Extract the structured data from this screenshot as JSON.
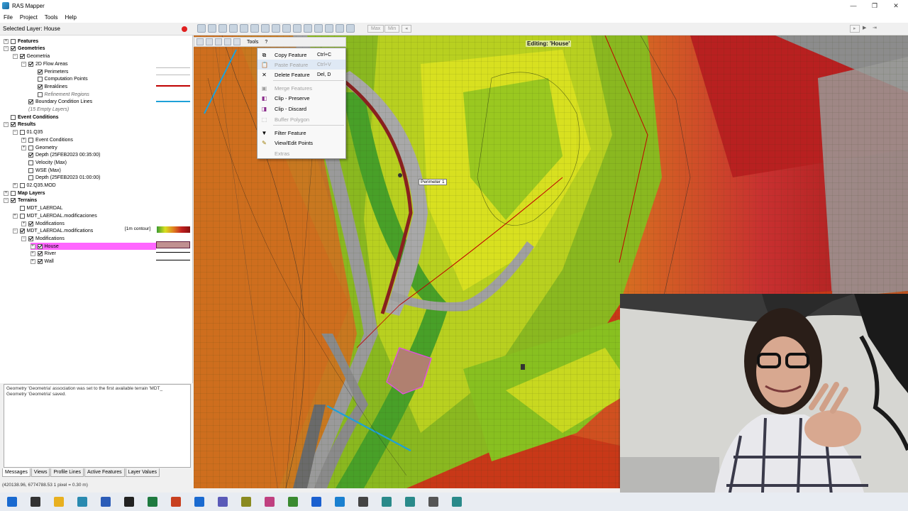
{
  "window": {
    "title": "RAS Mapper",
    "min_icon": "minimize-icon",
    "max_icon": "maximize-icon",
    "close_icon": "close-icon"
  },
  "menu": [
    "File",
    "Project",
    "Tools",
    "Help"
  ],
  "toolbar": {
    "selected_layer": "Selected Layer: House",
    "max_label": "Max",
    "min_label": "Min"
  },
  "tree": [
    {
      "label": "Features",
      "indent": 0,
      "exp": "+",
      "checked": false,
      "style": "bold"
    },
    {
      "label": "Geometries",
      "indent": 0,
      "exp": "−",
      "checked": true,
      "style": "bold"
    },
    {
      "label": "Geometria",
      "indent": 1,
      "exp": "−",
      "checked": true,
      "style": ""
    },
    {
      "label": "2D Flow Areas",
      "indent": 2,
      "exp": "−",
      "checked": true,
      "style": ""
    },
    {
      "label": "Perimeters",
      "indent": 3,
      "exp": "",
      "checked": true,
      "style": ""
    },
    {
      "label": "Computation Points",
      "indent": 3,
      "exp": "",
      "checked": false,
      "style": ""
    },
    {
      "label": "Breaklines",
      "indent": 3,
      "exp": "",
      "checked": true,
      "style": ""
    },
    {
      "label": "Refinement Regions",
      "indent": 3,
      "exp": "",
      "checked": false,
      "style": "italic"
    },
    {
      "label": "Boundary Condition Lines",
      "indent": 2,
      "exp": "",
      "checked": true,
      "style": ""
    },
    {
      "label": "(15 Empty Layers)",
      "indent": 2,
      "exp": "",
      "checked": null,
      "style": "italic"
    },
    {
      "label": "Event Conditions",
      "indent": 0,
      "exp": "",
      "checked": false,
      "style": "bold"
    },
    {
      "label": "Results",
      "indent": 0,
      "exp": "−",
      "checked": true,
      "style": "bold"
    },
    {
      "label": "01.Q35",
      "indent": 1,
      "exp": "−",
      "checked": false,
      "style": ""
    },
    {
      "label": "Event Conditions",
      "indent": 2,
      "exp": "+",
      "checked": false,
      "style": ""
    },
    {
      "label": "Geometry",
      "indent": 2,
      "exp": "+",
      "checked": false,
      "style": ""
    },
    {
      "label": "Depth (25FEB2023 00:35:00)",
      "indent": 2,
      "exp": "",
      "checked": true,
      "style": ""
    },
    {
      "label": "Velocity (Max)",
      "indent": 2,
      "exp": "",
      "checked": false,
      "style": ""
    },
    {
      "label": "WSE (Max)",
      "indent": 2,
      "exp": "",
      "checked": false,
      "style": ""
    },
    {
      "label": "Depth (25FEB2023 01:00:00)",
      "indent": 2,
      "exp": "",
      "checked": false,
      "style": ""
    },
    {
      "label": "02.Q35.MOD",
      "indent": 1,
      "exp": "+",
      "checked": false,
      "style": ""
    },
    {
      "label": "Map Layers",
      "indent": 0,
      "exp": "+",
      "checked": false,
      "style": "bold"
    },
    {
      "label": "Terrains",
      "indent": 0,
      "exp": "−",
      "checked": true,
      "style": "bold"
    },
    {
      "label": "MDT_LAERDAL",
      "indent": 1,
      "exp": "",
      "checked": false,
      "style": ""
    },
    {
      "label": "MDT_LAERDAL.modificaciones",
      "indent": 1,
      "exp": "+",
      "checked": false,
      "style": ""
    },
    {
      "label": "Modifications",
      "indent": 2,
      "exp": "+",
      "checked": true,
      "style": ""
    },
    {
      "label": "MDT_LAERDAL.modifications",
      "indent": 1,
      "exp": "−",
      "checked": true,
      "style": ""
    },
    {
      "label": "Modifications",
      "indent": 2,
      "exp": "−",
      "checked": true,
      "style": ""
    },
    {
      "label": "House",
      "indent": 3,
      "exp": "+",
      "checked": true,
      "style": "selected"
    },
    {
      "label": "River",
      "indent": 3,
      "exp": "+",
      "checked": true,
      "style": ""
    },
    {
      "label": "Wall",
      "indent": 3,
      "exp": "+",
      "checked": true,
      "style": ""
    }
  ],
  "contour_label": "[1m contour]",
  "log": {
    "line1": "Geometry 'Geometria' association was set to the first available terrain 'MDT_",
    "line2": "Geometry 'Geometria' saved."
  },
  "bottom_tabs": [
    "Messages",
    "Views",
    "Profile Lines",
    "Active Features",
    "Layer Values"
  ],
  "status": "(420138.96, 6774788.53  1 pixel = 0.30 m)",
  "map": {
    "editing": "Editing: 'House'",
    "tools_label": "Tools",
    "help_label": "?",
    "perimeter_label": "Perimeter 1"
  },
  "context_menu": [
    {
      "label": "Copy Feature",
      "key": "Ctrl+C",
      "icon": "copy-icon",
      "disabled": false
    },
    {
      "label": "Paste Feature",
      "key": "Ctrl+V",
      "icon": "paste-icon",
      "disabled": true
    },
    {
      "label": "Delete Feature",
      "key": "Del, D",
      "icon": "delete-icon",
      "disabled": false
    },
    {
      "label": "Merge Features",
      "key": "",
      "icon": "merge-icon",
      "disabled": true
    },
    {
      "label": "Clip - Preserve",
      "key": "",
      "icon": "clip-preserve-icon",
      "disabled": false
    },
    {
      "label": "Clip - Discard",
      "key": "",
      "icon": "clip-discard-icon",
      "disabled": false
    },
    {
      "label": "Buffer Polygon",
      "key": "",
      "icon": "buffer-icon",
      "disabled": true
    },
    {
      "label": "Filter Feature",
      "key": "",
      "icon": "filter-icon",
      "disabled": false
    },
    {
      "label": "View/Edit Points",
      "key": "",
      "icon": "points-icon",
      "disabled": false
    },
    {
      "label": "Extras",
      "key": "",
      "icon": "",
      "disabled": true
    }
  ],
  "taskbar_apps": [
    "start-icon",
    "search-icon",
    "file-explorer-icon",
    "browser-icon",
    "word-icon",
    "obs-icon",
    "excel-icon",
    "powerpoint-icon",
    "outlook-icon",
    "teams-icon",
    "app-icon",
    "snipping-icon",
    "chrome-icon",
    "dropbox-icon",
    "edge-icon",
    "app2-icon",
    "hec-ras-icon",
    "hec-ras-mapper-icon",
    "settings-icon",
    "hec-ras-2-icon"
  ],
  "colors": {
    "selected_bg": "#ff66ff",
    "breakline": "#c00000",
    "bc_line": "#1ea0d8",
    "accent": "#1b6aa0"
  }
}
